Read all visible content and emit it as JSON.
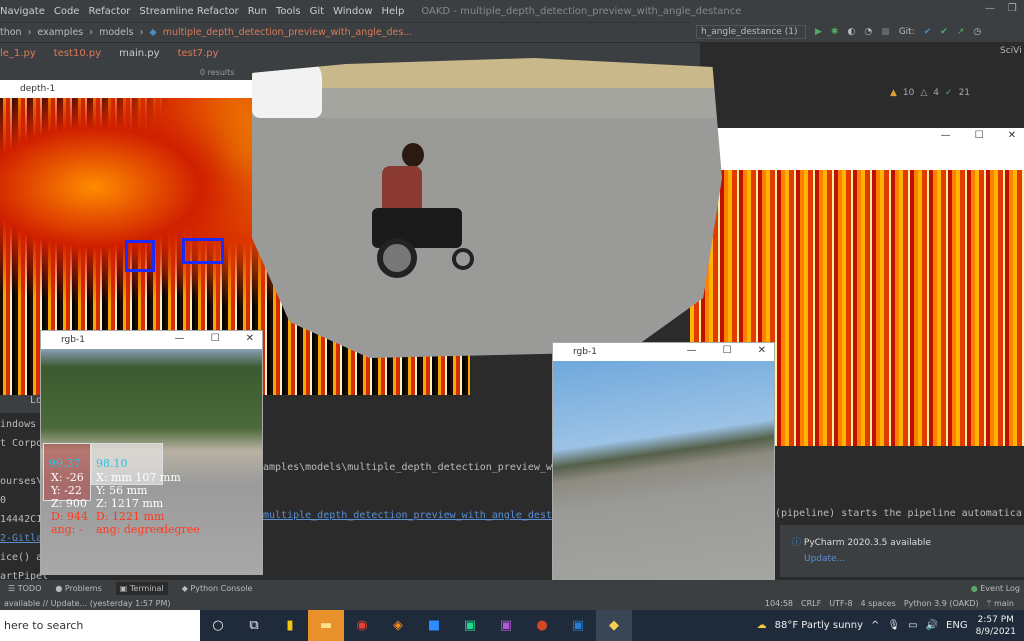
{
  "menu": {
    "items": [
      "Navigate",
      "Code",
      "Refactor",
      "Streamline Refactor",
      "Run",
      "Tools",
      "Git",
      "Window",
      "Help"
    ],
    "title": "OAKD - multiple_depth_detection_preview_with_angle_destance"
  },
  "breadcrumb": [
    "thon",
    "examples",
    "models",
    "multiple_depth_detection_preview_with_angle_des..."
  ],
  "tabs": [
    "le_1.py",
    "test10.py",
    "main.py",
    "test7.py"
  ],
  "find": {
    "results": "0 results"
  },
  "run_config": "h_angle_destance (1)",
  "git_label": "Git:",
  "side_tab": "SciVi",
  "inspections": {
    "warnings": "10",
    "weak": "4",
    "ok": "21"
  },
  "windows": {
    "depth_left": "depth-1",
    "rgb_left": "rgb-1",
    "rgb_right": "rgb-1"
  },
  "detections": {
    "a": {
      "conf": "99.37",
      "x": "X: -26",
      "y": "Y: -22",
      "z": "Z: 900",
      "d": "D: 944",
      "ang": "ang: -"
    },
    "b": {
      "conf": "98.10",
      "x": "X: mm 107 mm",
      "y": "Y: 56 mm",
      "z": "Z: 1217 mm",
      "d": "D: 1221 mm",
      "ang": "ang: degree"
    },
    "deg": "degree"
  },
  "terminal": {
    "tab": "Lo",
    "lines": [
      "indows [",
      "t Corpo",
      "ourses\\2",
      "0",
      "14442C1",
      "2-Gitlab",
      "ice() a",
      "artPipel"
    ],
    "path": "amples\\models\\multiple_depth_detection_preview_wi",
    "link": "multiple_depth_detection_preview_with_angle_desta",
    "pipeline": "(pipeline) starts the pipeline automatica"
  },
  "notification": {
    "title": "PyCharm 2020.3.5 available",
    "action": "Update..."
  },
  "tool_windows": [
    "TODO",
    "Problems",
    "Terminal",
    "Python Console"
  ],
  "event_log": "Event Log",
  "status": {
    "message": "available // Update... (yesterday 1:57 PM)",
    "position": "104:58",
    "line_sep": "CRLF",
    "encoding": "UTF-8",
    "indent": "4 spaces",
    "interpreter": "Python 3.9 (OAKD)",
    "branch": "main"
  },
  "taskbar": {
    "search": "here to search",
    "weather": "88°F  Partly sunny",
    "lang": "ENG",
    "time": "2:57 PM",
    "date": "8/9/2021"
  },
  "colors": {
    "ide_bg": "#2b2b2b",
    "detect_box": "#1a2bff",
    "detect_text": "#ff3b1f",
    "conf_text": "#29c4e0"
  }
}
